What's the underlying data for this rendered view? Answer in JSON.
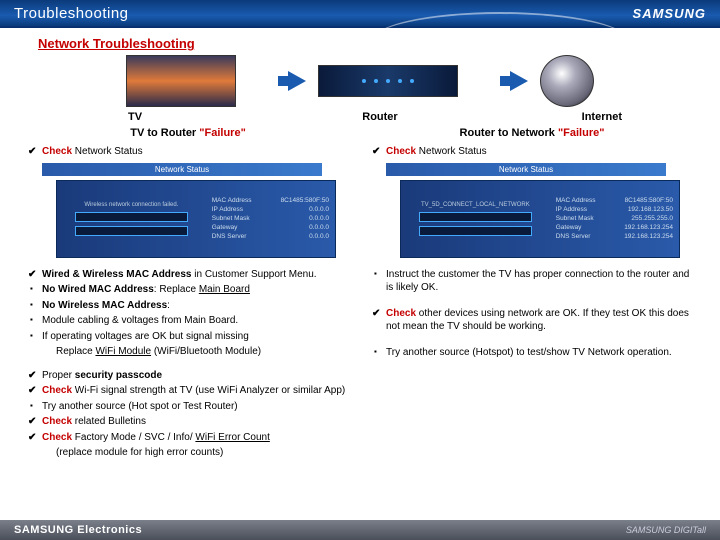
{
  "header": {
    "title": "Troubleshooting",
    "logo": "SAMSUNG"
  },
  "section_title": "Network Troubleshooting",
  "flow": {
    "tv": "TV",
    "router": "Router",
    "internet": "Internet"
  },
  "left": {
    "title_pre": "TV to Router ",
    "title_fail": "\"Failure\"",
    "check_status": {
      "red": "Check",
      "rest": " Network Status"
    },
    "panel": {
      "title": "Network Status",
      "msg": "Wireless network connection failed.",
      "rows": [
        [
          "MAC Address",
          "8C1485:580F:50"
        ],
        [
          "IP Address",
          "0.0.0.0"
        ],
        [
          "Subnet Mask",
          "0.0.0.0"
        ],
        [
          "Gateway",
          "0.0.0.0"
        ],
        [
          "DNS Server",
          "0.0.0.0"
        ]
      ]
    },
    "bullets1": [
      {
        "type": "check",
        "html": "<span class='bold'>Wired & Wireless MAC Address</span> in Customer Support Menu."
      },
      {
        "type": "bullet",
        "html": "<span class='bold'>No Wired MAC Address</span>: Replace <span class='u'>Main Board</span>"
      },
      {
        "type": "bullet",
        "html": "<span class='bold'>No Wireless MAC Address</span>:"
      },
      {
        "type": "bullet",
        "html": "Module cabling & voltages from Main Board."
      },
      {
        "type": "bullet",
        "html": "If operating voltages are OK but signal missing"
      },
      {
        "type": "plain",
        "html": "Replace <span class='u'>WiFi Module</span> (WiFi/Bluetooth Module)"
      }
    ],
    "bullets2": [
      {
        "type": "check",
        "html": "Proper <span class='bold'>security passcode</span>"
      },
      {
        "type": "check",
        "html": "<span class='red'>Check</span>  Wi-Fi signal strength at TV   (use WiFi Analyzer or similar App)"
      },
      {
        "type": "bullet",
        "html": "Try another source (Hot spot or Test Router)"
      },
      {
        "type": "check",
        "html": "<span class='red'>Check</span> related Bulletins"
      },
      {
        "type": "check",
        "html": "<span class='red'>Check</span> Factory Mode / SVC / Info/ <span class='u'>WiFi Error Count</span>"
      },
      {
        "type": "plain",
        "html": " (replace module for high error counts)"
      }
    ]
  },
  "right": {
    "title_pre": "Router to Network ",
    "title_fail": "\"Failure\"",
    "check_status": {
      "red": "Check",
      "rest": " Network Status"
    },
    "panel": {
      "title": "Network Status",
      "msg": "TV_5D_CONNECT_LOCAL_NETWORK",
      "rows": [
        [
          "MAC Address",
          "8C1485:580F:50"
        ],
        [
          "IP Address",
          "192.168.123.50"
        ],
        [
          "Subnet Mask",
          "255.255.255.0"
        ],
        [
          "Gateway",
          "192.168.123.254"
        ],
        [
          "DNS Server",
          "192.168.123.254"
        ]
      ]
    },
    "bullets": [
      {
        "type": "bullet",
        "html": "Instruct the customer the TV has proper connection to the router and is likely OK."
      },
      {
        "type": "gap"
      },
      {
        "type": "check",
        "html": "<span class='red'>Check</span> other devices using network are OK. If they test OK this does not mean the TV should be working."
      },
      {
        "type": "gap"
      },
      {
        "type": "bullet",
        "html": "Try another source (Hotspot)  to test/show TV Network operation."
      }
    ]
  },
  "footer": {
    "left": "SAMSUNG Electronics",
    "right": "SAMSUNG DIGITall"
  }
}
